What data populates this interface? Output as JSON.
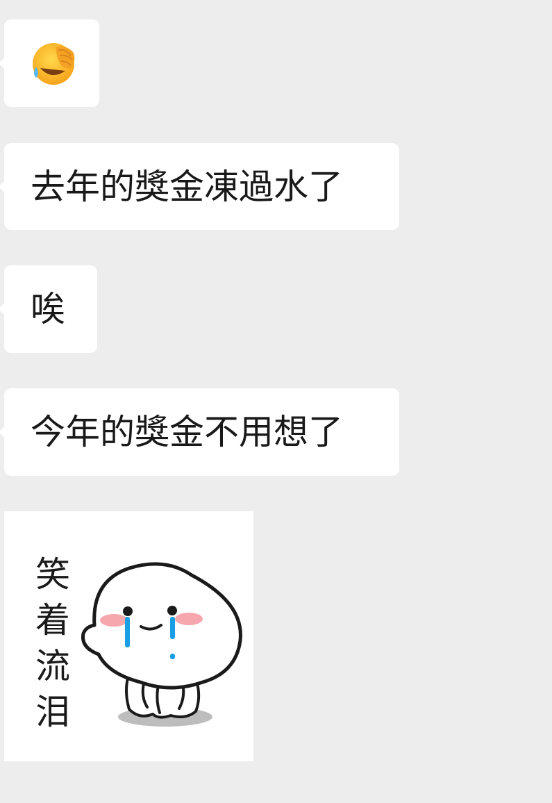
{
  "conversation": {
    "messages": [
      {
        "type": "emoji",
        "icon": "face-palm-laughing-icon"
      },
      {
        "type": "text",
        "text": "去年的獎金凍過水了"
      },
      {
        "type": "text",
        "text": "唉"
      },
      {
        "type": "text",
        "text": "今年的獎金不用想了"
      },
      {
        "type": "sticker",
        "icon": "crying-smiling-blob-icon",
        "caption_chars": [
          "笑",
          "着",
          "流",
          "泪"
        ]
      }
    ]
  },
  "colors": {
    "background": "#ededed",
    "bubble": "#ffffff",
    "text": "#191919",
    "tears": "#1a9ee6",
    "blush": "#f6a7ae"
  }
}
